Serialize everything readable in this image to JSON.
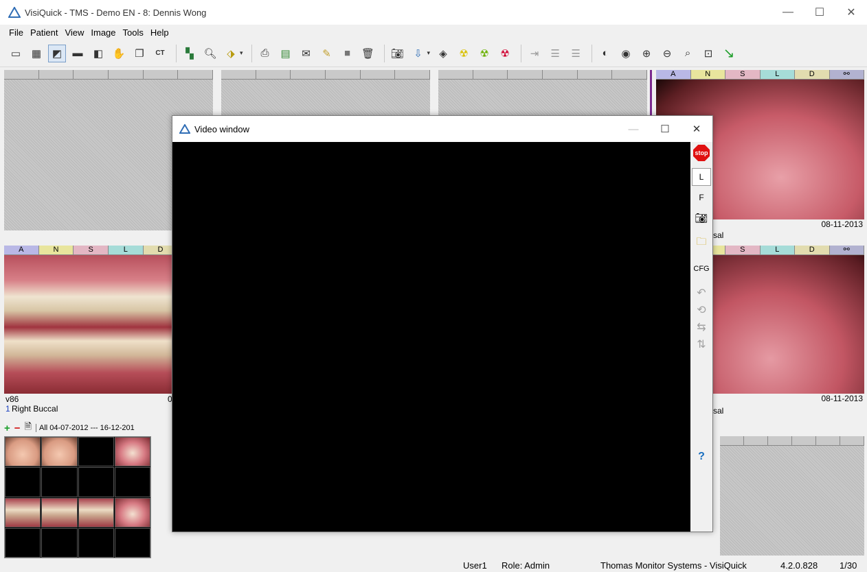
{
  "window": {
    "title": "VisiQuick - TMS - Demo EN - 8: Dennis Wong",
    "minimize": "—",
    "maximize": "☐",
    "close": "✕"
  },
  "menu": {
    "file": "File",
    "patient": "Patient",
    "view": "View",
    "image": "Image",
    "tools": "Tools",
    "help": "Help"
  },
  "toolbar": {
    "ct_label": "CT"
  },
  "strip_labels": {
    "a": "A",
    "n": "N",
    "s": "S",
    "l": "L",
    "d": "D"
  },
  "panels": {
    "top_right_date": "08-11-2013",
    "top_right_caption": "sal",
    "mid_left_code": "v86",
    "mid_left_number": "1",
    "mid_left_caption": "Right Buccal",
    "mid_left_date_fragment": "0",
    "mid_right_date": "08-11-2013",
    "mid_right_caption": "sal"
  },
  "thumbnails": {
    "add": "+",
    "remove": "−",
    "filter_tab": "All 04-07-2012 --- 16-12-201"
  },
  "video_window": {
    "title": "Video window",
    "minimize": "—",
    "maximize": "☐",
    "close": "✕",
    "stop_label": "stop",
    "l_label": "L",
    "f_label": "F",
    "cfg_label": "CFG",
    "help_label": "?"
  },
  "status": {
    "user": "User1",
    "role": "Role: Admin",
    "company": "Thomas Monitor Systems - VisiQuick",
    "version": "4.2.0.828",
    "page": "1/30"
  },
  "colors": {
    "accent_purple": "#7b2a8e",
    "stop_red": "#e01010",
    "help_blue": "#1a6fc0"
  }
}
